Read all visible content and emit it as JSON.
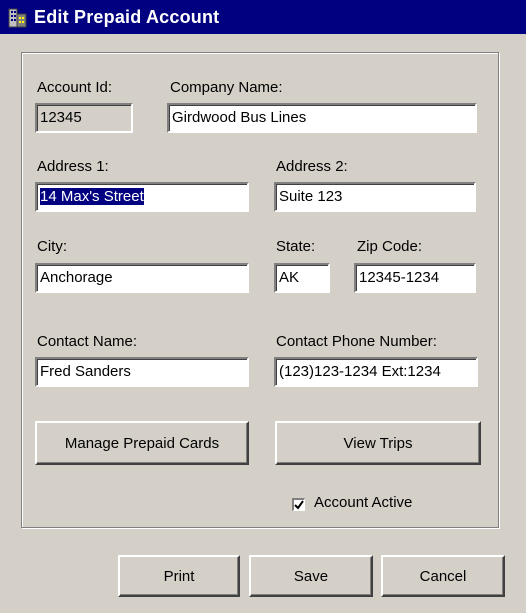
{
  "window": {
    "title": "Edit Prepaid Account"
  },
  "form": {
    "account_id": {
      "label": "Account Id:",
      "value": "12345"
    },
    "company_name": {
      "label": "Company Name:",
      "value": "Girdwood Bus Lines"
    },
    "address1": {
      "label": "Address 1:",
      "value": "14 Max's Street"
    },
    "address2": {
      "label": "Address 2:",
      "value": "Suite 123"
    },
    "city": {
      "label": "City:",
      "value": "Anchorage"
    },
    "state": {
      "label": "State:",
      "value": "AK"
    },
    "zip": {
      "label": "Zip Code:",
      "value": "12345-1234"
    },
    "contact_name": {
      "label": "Contact Name:",
      "value": "Fred Sanders"
    },
    "contact_phone": {
      "label": "Contact Phone Number:",
      "value": "(123)123-1234 Ext:1234"
    }
  },
  "buttons": {
    "manage_cards": "Manage Prepaid Cards",
    "view_trips": "View Trips",
    "print": "Print",
    "save": "Save",
    "cancel": "Cancel"
  },
  "account_active": {
    "label": "Account Active",
    "checked": true
  },
  "colors": {
    "titlebar": "#000080",
    "face": "#d4d0c8",
    "selection": "#000080"
  },
  "icons": {
    "app": "building-icon",
    "check": "checkmark-icon"
  }
}
